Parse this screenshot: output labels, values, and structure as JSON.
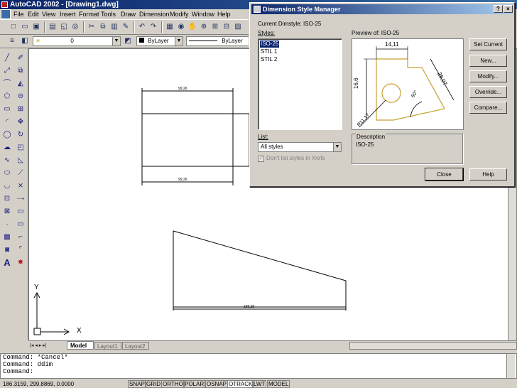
{
  "app": {
    "title": "AutoCAD 2002 - [Drawing1.dwg]"
  },
  "menu": [
    "File",
    "Edit",
    "View",
    "Insert",
    "Format",
    "Tools",
    "Draw",
    "Dimension",
    "Modify",
    "Window",
    "Help"
  ],
  "toolbar": {
    "layer_value": "0",
    "color_value": "ByLayer",
    "linetype_value": "ByLayer"
  },
  "drawing": {
    "dims": [
      "99,26",
      "99,26",
      "185,25"
    ],
    "ucs": {
      "x": "X",
      "y": "Y"
    }
  },
  "tabs": [
    "Model",
    "Layout1",
    "Layout2"
  ],
  "command": {
    "lines": [
      "Command: *Cancel*",
      "Command: ddim",
      "Command:"
    ]
  },
  "status": {
    "coords": "186.3159, 299.8869, 0.0000",
    "buttons": [
      "SNAP",
      "GRID",
      "ORTHO",
      "POLAR",
      "OSNAP",
      "OTRACK",
      "LWT",
      "MODEL"
    ]
  },
  "dialog": {
    "title": "Dimension Style Manager",
    "current": "Current Dimstyle: ISO-25",
    "styles_label": "Styles:",
    "styles": [
      "ISO-25",
      "STIL 1",
      "STIL 2"
    ],
    "preview_label": "Preview of: ISO-25",
    "list_label": "List:",
    "list_value": "All styles",
    "xref_label": "Don't list styles in Xrefs",
    "desc_label": "Description",
    "desc_value": "ISO-25",
    "preview_dims": [
      "14,11",
      "16,6",
      "28,07",
      "60°",
      "R11,17"
    ],
    "buttons": {
      "set_current": "Set Current",
      "new": "New...",
      "modify": "Modify...",
      "override": "Override...",
      "compare": "Compare...",
      "close": "Close",
      "help": "Help"
    }
  }
}
